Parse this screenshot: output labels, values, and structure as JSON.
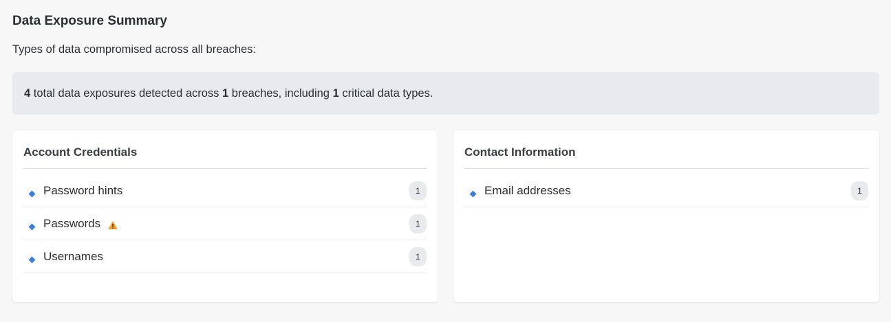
{
  "header": {
    "title": "Data Exposure Summary",
    "subtitle": "Types of data compromised across all breaches:"
  },
  "summary": {
    "total_exposures": "4",
    "text_part1": " total data exposures detected across ",
    "breaches": "1",
    "text_part2": " breaches, including ",
    "critical_types": "1",
    "text_part3": " critical data types."
  },
  "cards": [
    {
      "title": "Account Credentials",
      "items": [
        {
          "label": "Password hints",
          "count": "1",
          "critical": false
        },
        {
          "label": "Passwords",
          "count": "1",
          "critical": true
        },
        {
          "label": "Usernames",
          "count": "1",
          "critical": false
        }
      ]
    },
    {
      "title": "Contact Information",
      "items": [
        {
          "label": "Email addresses",
          "count": "1",
          "critical": false
        }
      ]
    }
  ],
  "icons": {
    "bullet": "diamond-icon",
    "critical": "warning-icon"
  },
  "colors": {
    "bullet": "#3b7dd8",
    "warning": "#f0a030",
    "summary_bg": "#e8eaed"
  }
}
